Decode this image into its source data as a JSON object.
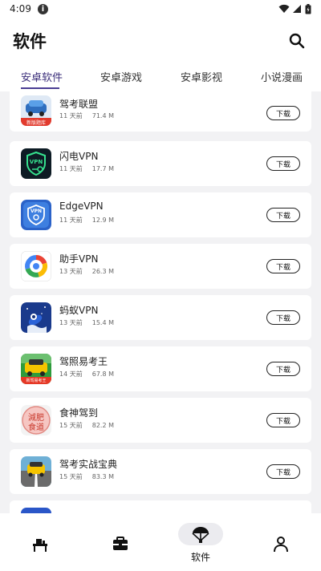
{
  "status_bar": {
    "time": "4:09",
    "info_glyph": "i"
  },
  "header": {
    "title": "软件"
  },
  "tabs": [
    {
      "label": "安卓软件",
      "active": true
    },
    {
      "label": "安卓游戏",
      "active": false
    },
    {
      "label": "安卓影视",
      "active": false
    },
    {
      "label": "小说漫画",
      "active": false
    }
  ],
  "apps": [
    {
      "name": "驾考联盟",
      "date": "11 天前",
      "size": "71.4 M",
      "icon": "car-exam-icon",
      "download_label": "下载"
    },
    {
      "name": "闪电VPN",
      "date": "11 天前",
      "size": "17.7 M",
      "icon": "vpn-shield-key-icon",
      "download_label": "下载"
    },
    {
      "name": "EdgeVPN",
      "date": "11 天前",
      "size": "12.9 M",
      "icon": "vpn-blue-shield-icon",
      "download_label": "下载"
    },
    {
      "name": "助手VPN",
      "date": "13 天前",
      "size": "26.3 M",
      "icon": "colorful-ring-icon",
      "download_label": "下载"
    },
    {
      "name": "蚂蚁VPN",
      "date": "13 天前",
      "size": "15.4 M",
      "icon": "rocket-icon",
      "download_label": "下载"
    },
    {
      "name": "驾照易考王",
      "date": "14 天前",
      "size": "67.8 M",
      "icon": "taxi-icon",
      "download_label": "下载"
    },
    {
      "name": "食神驾到",
      "date": "15 天前",
      "size": "82.2 M",
      "icon": "food-seal-icon",
      "download_label": "下载"
    },
    {
      "name": "驾考实战宝典",
      "date": "15 天前",
      "size": "83.3 M",
      "icon": "road-car-icon",
      "download_label": "下载"
    }
  ],
  "icon_texts": {
    "car_exam_banner": "新版题库",
    "vpn_badge": "VPN",
    "edge_badge": "VPN",
    "taxi_banner": "新驾易考王",
    "food_seal_top": "減肥",
    "food_seal_bottom": "食道"
  },
  "bottom_nav": [
    {
      "label": "",
      "icon": "desk-icon",
      "active": false
    },
    {
      "label": "",
      "icon": "briefcase-icon",
      "active": false
    },
    {
      "label": "软件",
      "icon": "parachute-icon",
      "active": true
    },
    {
      "label": "",
      "icon": "person-icon",
      "active": false
    }
  ],
  "colors": {
    "accent": "#4a3d93",
    "background": "#f2f2f4"
  }
}
